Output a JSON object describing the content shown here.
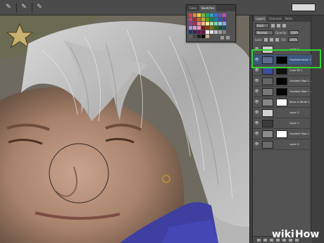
{
  "swatches_panel": {
    "tabs": [
      "Color",
      "Swatches"
    ],
    "swatch_colors": [
      "#e04040",
      "#e08a3a",
      "#f0d040",
      "#70c040",
      "#30a070",
      "#30a0c0",
      "#3a70d0",
      "#7050c0",
      "#c050b0",
      "#d04070",
      "#b02828",
      "#c06828",
      "#c0a828",
      "#50a028",
      "#208058",
      "#2080a0",
      "#2858b0",
      "#5838a0",
      "#a03890",
      "#b02858",
      "#f08888",
      "#f0b888",
      "#f8e898",
      "#a8e098",
      "#80d0b0",
      "#80d0e8",
      "#88a8e8",
      "#a898e0",
      "#e098d8",
      "#f098b8",
      "#701818",
      "#804018",
      "#807018",
      "#306818",
      "#105038",
      "#105068",
      "#183870",
      "#382068",
      "#681858",
      "#701838",
      "#ffffff",
      "#e0e0e0",
      "#c0c0c0",
      "#a0a0a0",
      "#808080",
      "#606060",
      "#404040",
      "#202020",
      "#000000",
      "#c8b090"
    ]
  },
  "layers_panel": {
    "tabs": [
      "Layers",
      "Channels",
      "Paths"
    ],
    "filter_kind": "Kind",
    "blend_mode": "Normal",
    "opacity_label": "Opacity:",
    "opacity_value": "100%",
    "lock_label": "Lock:",
    "fill_label": "Fill:",
    "fill_value": "100%",
    "layers": [
      {
        "name": "Layer 2",
        "thumb": "#c9c9c9",
        "mask": null,
        "selected": false
      },
      {
        "name": "Hue/Saturation 1",
        "thumb": "#5b6c8f",
        "mask": "#000000",
        "selected": true
      },
      {
        "name": "Color Fill 1",
        "thumb": "#3c4fa0",
        "mask": "#101010",
        "selected": false
      },
      {
        "name": "Gradient Map 1 ...",
        "thumb": "#666666",
        "mask": "#050505",
        "selected": false
      },
      {
        "name": "Gradient Map 1 ...",
        "thumb": "#777777",
        "mask": "#050505",
        "selected": false
      },
      {
        "name": "Black & White 1",
        "thumb": "#888888",
        "mask": "#ffffff",
        "selected": false
      },
      {
        "name": "Layer 3",
        "thumb": "#d0d0d0",
        "mask": null,
        "selected": false
      },
      {
        "name": "Layer 1",
        "thumb": "#3a3a3a",
        "mask": null,
        "selected": false
      },
      {
        "name": "Gradient Map 1",
        "thumb": "#8a8a8a",
        "mask": "#ffffff",
        "selected": false
      },
      {
        "name": "Layer 0",
        "thumb": "#6a6a6a",
        "mask": null,
        "selected": false
      }
    ]
  },
  "watermark": {
    "text_wiki": "wiki",
    "text_how": "How"
  }
}
